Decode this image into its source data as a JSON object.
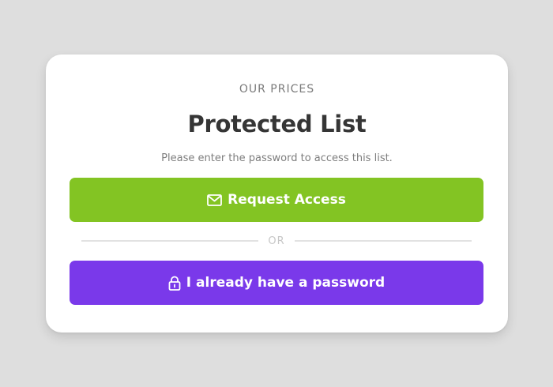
{
  "card": {
    "eyebrow": "OUR PRICES",
    "title": "Protected List",
    "subtitle": "Please enter the password to access this list.",
    "request_button": {
      "label": "Request Access",
      "icon": "envelope-icon",
      "color": "#83c423"
    },
    "divider_text": "OR",
    "password_button": {
      "label": "I already have a password",
      "icon": "lock-icon",
      "color": "#7a39ea"
    }
  }
}
